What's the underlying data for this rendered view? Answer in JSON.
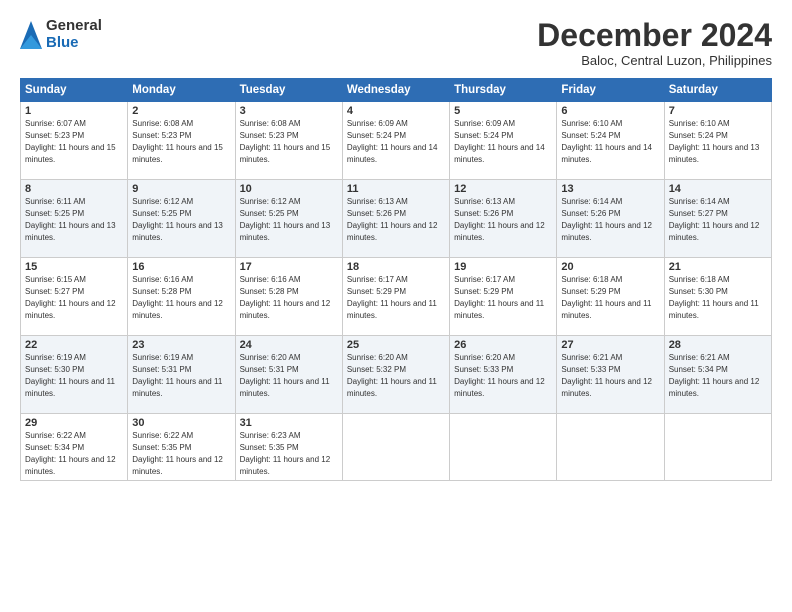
{
  "logo": {
    "general": "General",
    "blue": "Blue"
  },
  "title": "December 2024",
  "subtitle": "Baloc, Central Luzon, Philippines",
  "days_header": [
    "Sunday",
    "Monday",
    "Tuesday",
    "Wednesday",
    "Thursday",
    "Friday",
    "Saturday"
  ],
  "weeks": [
    [
      {
        "day": "1",
        "sunrise": "6:07 AM",
        "sunset": "5:23 PM",
        "daylight": "11 hours and 15 minutes."
      },
      {
        "day": "2",
        "sunrise": "6:08 AM",
        "sunset": "5:23 PM",
        "daylight": "11 hours and 15 minutes."
      },
      {
        "day": "3",
        "sunrise": "6:08 AM",
        "sunset": "5:23 PM",
        "daylight": "11 hours and 15 minutes."
      },
      {
        "day": "4",
        "sunrise": "6:09 AM",
        "sunset": "5:24 PM",
        "daylight": "11 hours and 14 minutes."
      },
      {
        "day": "5",
        "sunrise": "6:09 AM",
        "sunset": "5:24 PM",
        "daylight": "11 hours and 14 minutes."
      },
      {
        "day": "6",
        "sunrise": "6:10 AM",
        "sunset": "5:24 PM",
        "daylight": "11 hours and 14 minutes."
      },
      {
        "day": "7",
        "sunrise": "6:10 AM",
        "sunset": "5:24 PM",
        "daylight": "11 hours and 13 minutes."
      }
    ],
    [
      {
        "day": "8",
        "sunrise": "6:11 AM",
        "sunset": "5:25 PM",
        "daylight": "11 hours and 13 minutes."
      },
      {
        "day": "9",
        "sunrise": "6:12 AM",
        "sunset": "5:25 PM",
        "daylight": "11 hours and 13 minutes."
      },
      {
        "day": "10",
        "sunrise": "6:12 AM",
        "sunset": "5:25 PM",
        "daylight": "11 hours and 13 minutes."
      },
      {
        "day": "11",
        "sunrise": "6:13 AM",
        "sunset": "5:26 PM",
        "daylight": "11 hours and 12 minutes."
      },
      {
        "day": "12",
        "sunrise": "6:13 AM",
        "sunset": "5:26 PM",
        "daylight": "11 hours and 12 minutes."
      },
      {
        "day": "13",
        "sunrise": "6:14 AM",
        "sunset": "5:26 PM",
        "daylight": "11 hours and 12 minutes."
      },
      {
        "day": "14",
        "sunrise": "6:14 AM",
        "sunset": "5:27 PM",
        "daylight": "11 hours and 12 minutes."
      }
    ],
    [
      {
        "day": "15",
        "sunrise": "6:15 AM",
        "sunset": "5:27 PM",
        "daylight": "11 hours and 12 minutes."
      },
      {
        "day": "16",
        "sunrise": "6:16 AM",
        "sunset": "5:28 PM",
        "daylight": "11 hours and 12 minutes."
      },
      {
        "day": "17",
        "sunrise": "6:16 AM",
        "sunset": "5:28 PM",
        "daylight": "11 hours and 12 minutes."
      },
      {
        "day": "18",
        "sunrise": "6:17 AM",
        "sunset": "5:29 PM",
        "daylight": "11 hours and 11 minutes."
      },
      {
        "day": "19",
        "sunrise": "6:17 AM",
        "sunset": "5:29 PM",
        "daylight": "11 hours and 11 minutes."
      },
      {
        "day": "20",
        "sunrise": "6:18 AM",
        "sunset": "5:29 PM",
        "daylight": "11 hours and 11 minutes."
      },
      {
        "day": "21",
        "sunrise": "6:18 AM",
        "sunset": "5:30 PM",
        "daylight": "11 hours and 11 minutes."
      }
    ],
    [
      {
        "day": "22",
        "sunrise": "6:19 AM",
        "sunset": "5:30 PM",
        "daylight": "11 hours and 11 minutes."
      },
      {
        "day": "23",
        "sunrise": "6:19 AM",
        "sunset": "5:31 PM",
        "daylight": "11 hours and 11 minutes."
      },
      {
        "day": "24",
        "sunrise": "6:20 AM",
        "sunset": "5:31 PM",
        "daylight": "11 hours and 11 minutes."
      },
      {
        "day": "25",
        "sunrise": "6:20 AM",
        "sunset": "5:32 PM",
        "daylight": "11 hours and 11 minutes."
      },
      {
        "day": "26",
        "sunrise": "6:20 AM",
        "sunset": "5:33 PM",
        "daylight": "11 hours and 12 minutes."
      },
      {
        "day": "27",
        "sunrise": "6:21 AM",
        "sunset": "5:33 PM",
        "daylight": "11 hours and 12 minutes."
      },
      {
        "day": "28",
        "sunrise": "6:21 AM",
        "sunset": "5:34 PM",
        "daylight": "11 hours and 12 minutes."
      }
    ],
    [
      {
        "day": "29",
        "sunrise": "6:22 AM",
        "sunset": "5:34 PM",
        "daylight": "11 hours and 12 minutes."
      },
      {
        "day": "30",
        "sunrise": "6:22 AM",
        "sunset": "5:35 PM",
        "daylight": "11 hours and 12 minutes."
      },
      {
        "day": "31",
        "sunrise": "6:23 AM",
        "sunset": "5:35 PM",
        "daylight": "11 hours and 12 minutes."
      },
      null,
      null,
      null,
      null
    ]
  ],
  "labels": {
    "sunrise": "Sunrise:",
    "sunset": "Sunset:",
    "daylight": "Daylight:"
  }
}
